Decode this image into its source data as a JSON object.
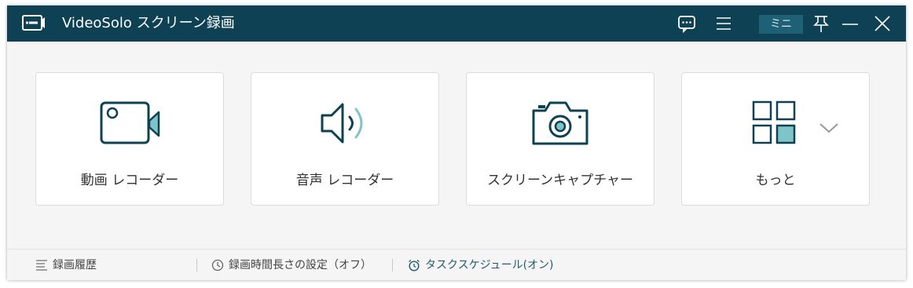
{
  "app": {
    "title": "VideoSolo スクリーン録画"
  },
  "titlebar": {
    "mini_label": "ミニ",
    "icons": [
      "feedback-icon",
      "menu-icon",
      "pin-icon",
      "minimize-icon",
      "close-icon"
    ]
  },
  "cards": [
    {
      "label": "動画 レコーダー",
      "icon": "video-camera-icon"
    },
    {
      "label": "音声 レコーダー",
      "icon": "speaker-icon"
    },
    {
      "label": "スクリーンキャプチャー",
      "icon": "camera-icon"
    },
    {
      "label": "もっと",
      "icon": "grid-icon"
    }
  ],
  "statusbar": {
    "history_label": "録画履歴",
    "duration_label": "録画時間長さの設定（オフ）",
    "schedule_label": "タスクスケジュール(オン)"
  },
  "colors": {
    "titlebar_bg": "#0d4153",
    "accent": "#0d4153",
    "icon_fill": "#7fc4c9",
    "schedule_text": "#1d5b72"
  }
}
